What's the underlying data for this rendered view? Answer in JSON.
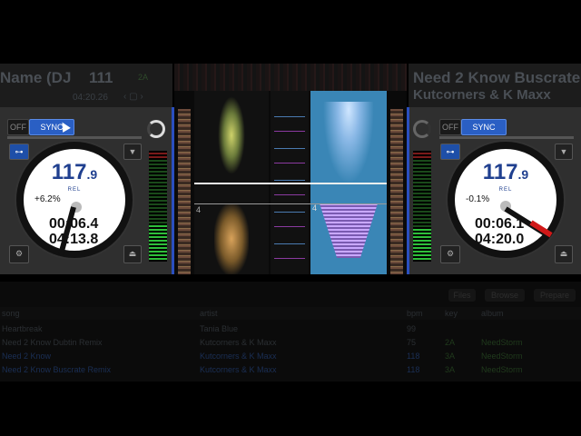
{
  "left_deck": {
    "title": "Name (DJ",
    "bpm_small": "111",
    "key": "2A",
    "time_header": "04:20.26",
    "off_label": "OFF",
    "sync_label": "SYNC",
    "bpm_int": "117",
    "bpm_dec": ".9",
    "rel_label": "REL",
    "pitch": "+6.2%",
    "elapsed": "00:06.4",
    "remaining": "04:13.8"
  },
  "right_deck": {
    "title": "Need 2 Know Buscrate",
    "artist": "Kutcorners & K Maxx",
    "off_label": "OFF",
    "sync_label": "SYNC",
    "bpm_int": "117",
    "bpm_dec": ".9",
    "rel_label": "REL",
    "pitch": "-0.1%",
    "elapsed": "00:06.1",
    "remaining": "04:20.0"
  },
  "waveform": {
    "beat_marker_left": "4",
    "beat_marker_right": "4"
  },
  "library": {
    "buttons": [
      "Files",
      "Browse",
      "Prepare"
    ],
    "headers": {
      "song": "song",
      "artist": "artist",
      "bpm": "bpm",
      "key": "key",
      "album": "album"
    },
    "rows": [
      {
        "song": "Heartbreak",
        "artist": "Tania Blue",
        "bpm": "99",
        "key": "",
        "album": ""
      },
      {
        "song": "Need 2 Know Dubtin Remix",
        "artist": "Kutcorners & K Maxx",
        "bpm": "75",
        "key": "2A",
        "album": "NeedStorm"
      },
      {
        "song": "Need 2 Know",
        "artist": "Kutcorners & K Maxx",
        "bpm": "118",
        "key": "3A",
        "album": "NeedStorm"
      },
      {
        "song": "Need 2 Know Buscrate Remix",
        "artist": "Kutcorners & K Maxx",
        "bpm": "118",
        "key": "3A",
        "album": "NeedStorm"
      }
    ]
  },
  "colors": {
    "accent": "#2a5fc4",
    "bpm_text": "#1f3f8f"
  }
}
